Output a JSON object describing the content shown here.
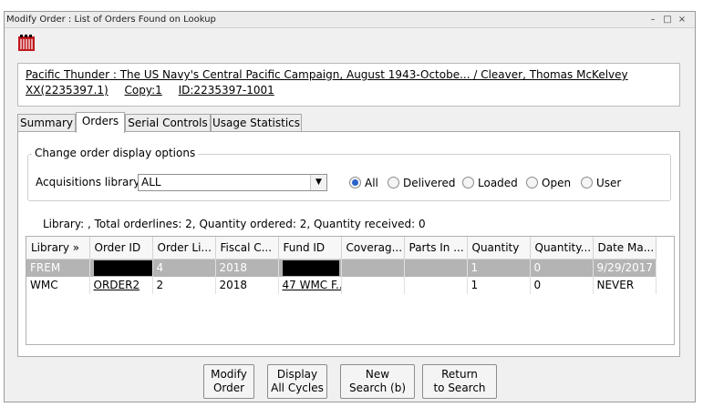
{
  "window": {
    "title": "Modify Order : List of Orders Found on Lookup",
    "controls": [
      "–",
      "□",
      "×"
    ]
  },
  "app_icon": "library-book-icon",
  "record": {
    "title_line": "Pacific Thunder : The US Navy's Central Pacific Campaign, August 1943-Octobe... / Cleaver, Thomas McKelvey",
    "xx": "XX(2235397.1)",
    "copy": "Copy:1",
    "id": "ID:2235397-1001"
  },
  "tabs": [
    "Summary",
    "Orders",
    "Serial Controls",
    "Usage Statistics"
  ],
  "active_tab": "Orders",
  "display_options": {
    "group_label": "Change order display options",
    "library_label": "Acquisitions library:",
    "library_value": "ALL",
    "radios": [
      "All",
      "Delivered",
      "Loaded",
      "Open",
      "User"
    ],
    "selected_radio": "All"
  },
  "summary": "Library: , Total orderlines: 2, Quantity ordered: 2, Quantity received: 0",
  "table": {
    "columns": [
      "Library »",
      "Order ID",
      "Order Li...",
      "Fiscal C...",
      "Fund ID",
      "Coverag...",
      "Parts In ...",
      "Quantity",
      "Quantity...",
      "Date Ma..."
    ],
    "rows": [
      [
        "FREM",
        "",
        "4",
        "2018",
        "",
        "",
        "",
        "1",
        "0",
        "9/29/2017"
      ],
      [
        "WMC",
        "ORDER2",
        "2",
        "2018",
        "47 WMC F...",
        "",
        "",
        "1",
        "0",
        "NEVER"
      ]
    ],
    "selected_row": 0
  },
  "buttons": [
    {
      "line1": "Modify",
      "line2": "Order"
    },
    {
      "line1": "Display",
      "line2": "All Cycles"
    },
    {
      "line1": "New",
      "line2": "Search (b)"
    },
    {
      "line1": "Return",
      "line2": "to Search"
    }
  ],
  "colors": {
    "selected_row_bg": "#b4b4b4",
    "radio_accent": "#2a62c9",
    "icon_red": "#c0181e"
  }
}
